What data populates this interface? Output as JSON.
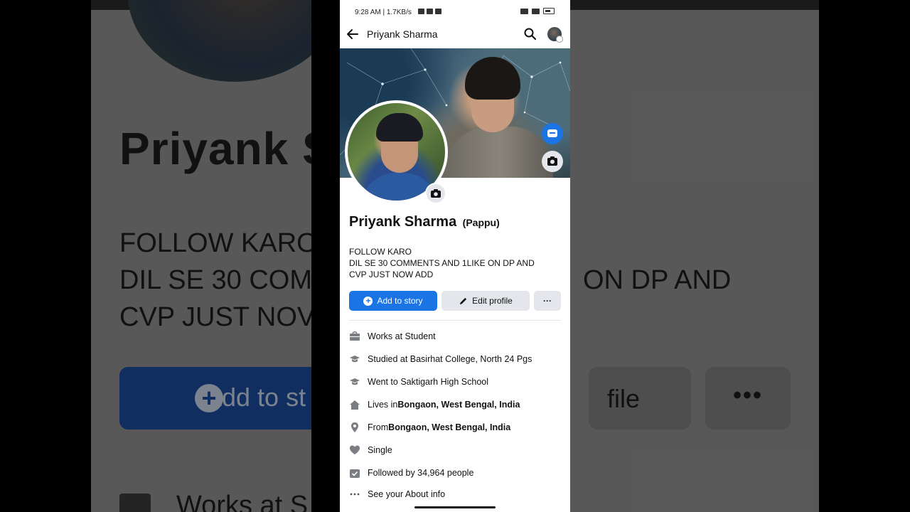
{
  "status_bar": {
    "time": "9:28 AM | 1.7KB/s"
  },
  "header": {
    "title": "Priyank Sharma"
  },
  "profile": {
    "name": "Priyank Sharma",
    "nickname": "(Pappu)",
    "bio_lines": [
      "FOLLOW KARO",
      "DIL SE 30 COMMENTS AND 1LIKE ON DP AND",
      "CVP JUST NOW ADD"
    ]
  },
  "actions": {
    "add_story": "Add to story",
    "edit_profile": "Edit profile",
    "more": "···"
  },
  "info": {
    "work": "Works at Student",
    "studied": "Studied at Basirhat College, North 24 Pgs",
    "went": "Went to Saktigarh High School",
    "lives_prefix": "Lives in ",
    "lives_place": "Bongaon, West Bengal, India",
    "from_prefix": "From ",
    "from_place": "Bongaon, West Bengal, India",
    "relationship": "Single",
    "followers": "Followed by 34,964 people",
    "about": "See your About info"
  },
  "background_copy": {
    "name": "Priyank S",
    "bio_1": "FOLLOW KARO",
    "bio_2": "DIL SE 30 COM",
    "bio_2b": "ON DP AND",
    "bio_3": "CVP JUST NOV",
    "add": "Add to st",
    "edit": "file",
    "more": "•••",
    "work": "Works at S"
  },
  "colors": {
    "accent": "#1b74e4",
    "button_gray": "#e4e6eb",
    "text": "#111111",
    "icon_gray": "#7a7d82"
  },
  "icons": [
    "back-arrow-icon",
    "search-icon",
    "messenger-icon",
    "camera-icon",
    "plus-icon",
    "pencil-icon",
    "briefcase-icon",
    "graduation-cap-icon",
    "home-icon",
    "location-pin-icon",
    "heart-icon",
    "followers-icon",
    "more-dots-icon"
  ]
}
